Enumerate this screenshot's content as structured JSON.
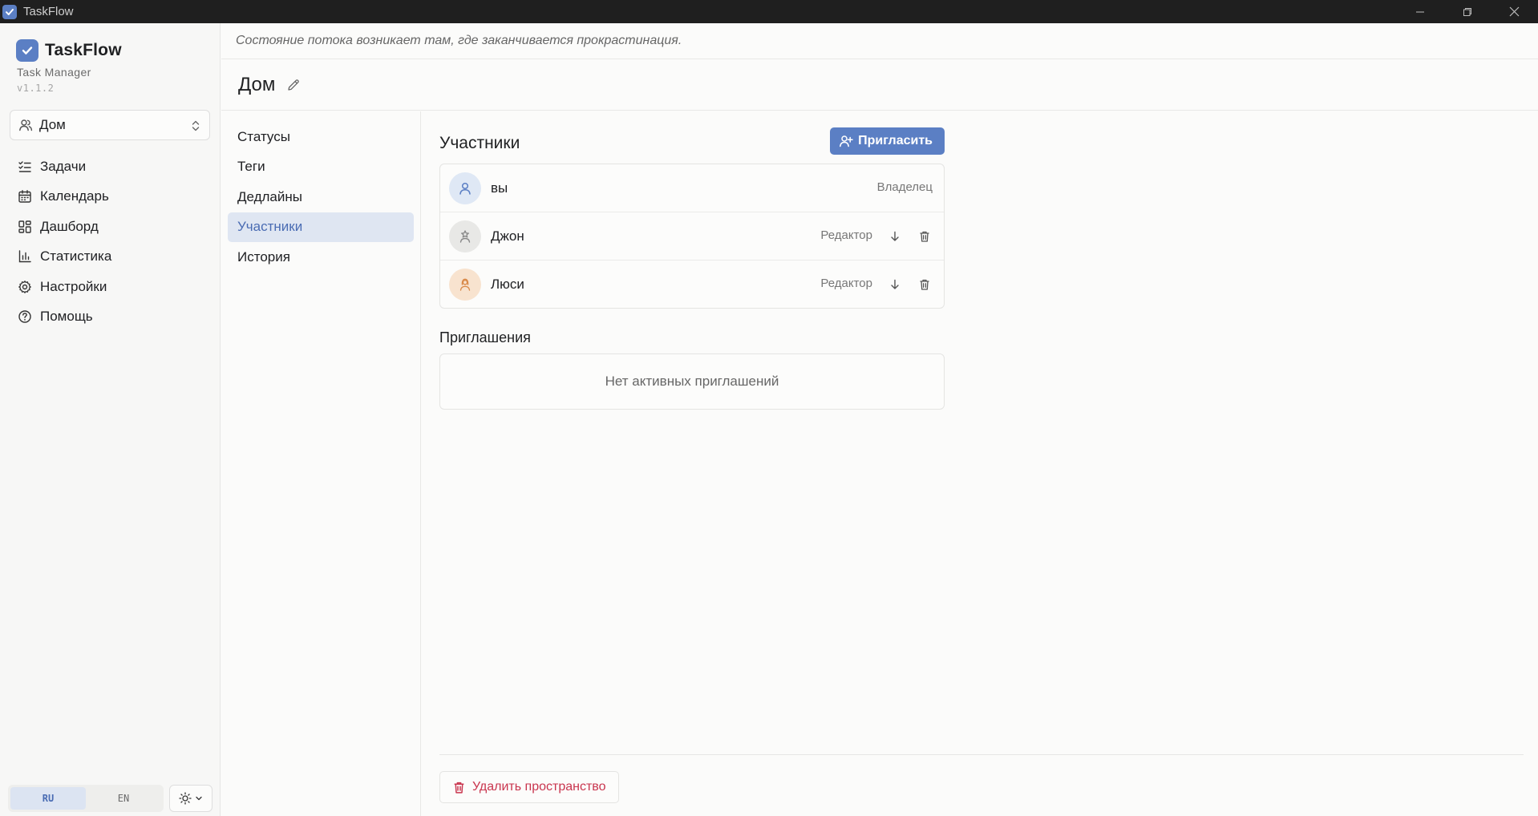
{
  "window": {
    "title": "TaskFlow"
  },
  "brand": {
    "name": "TaskFlow",
    "subtitle": "Task Manager",
    "version": "v1.1.2"
  },
  "space_selector": {
    "value": "Дом"
  },
  "nav": {
    "items": [
      {
        "label": "Задачи",
        "icon": "tasks-list-icon"
      },
      {
        "label": "Календарь",
        "icon": "calendar-icon"
      },
      {
        "label": "Дашборд",
        "icon": "dashboard-grid-icon"
      },
      {
        "label": "Статистика",
        "icon": "bar-chart-icon"
      },
      {
        "label": "Настройки",
        "icon": "gear-icon"
      },
      {
        "label": "Помощь",
        "icon": "help-circle-icon"
      }
    ]
  },
  "language": {
    "options": [
      "RU",
      "EN"
    ],
    "selected": "RU"
  },
  "quote": "Состояние потока возникает там, где заканчивается прокрастинация.",
  "page": {
    "title": "Дом"
  },
  "subnav": {
    "items": [
      "Статусы",
      "Теги",
      "Дедлайны",
      "Участники",
      "История"
    ],
    "active": "Участники"
  },
  "members_section": {
    "title": "Участники",
    "invite_label": "Пригласить",
    "members": [
      {
        "name": "вы",
        "role": "Владелец",
        "avatar_bg": "#dfe8f5",
        "avatar_color": "#5b7fc4"
      },
      {
        "name": "Джон",
        "role": "Редактор",
        "avatar_bg": "#e8e8e6",
        "avatar_color": "#888888"
      },
      {
        "name": "Люси",
        "role": "Редактор",
        "avatar_bg": "#f8e3cf",
        "avatar_color": "#d98a4a"
      }
    ]
  },
  "invitations": {
    "title": "Приглашения",
    "empty_text": "Нет активных приглашений"
  },
  "danger": {
    "delete_label": "Удалить пространство"
  },
  "colors": {
    "accent": "#5b7fc4",
    "danger": "#c9354e",
    "active_bg": "#dfe6f2"
  }
}
